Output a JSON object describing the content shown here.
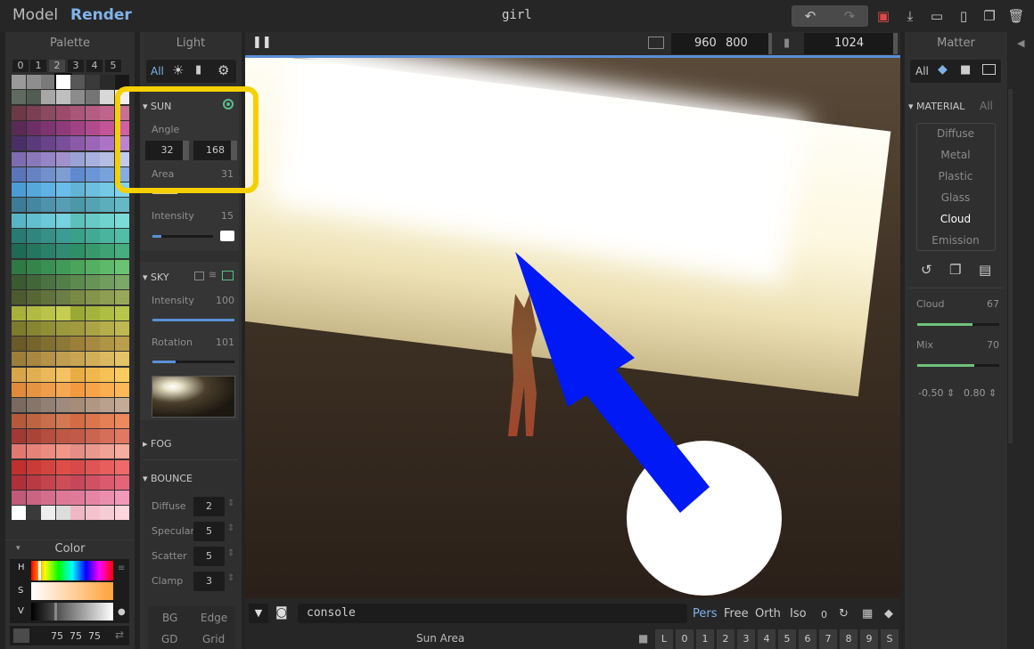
{
  "topbar": {
    "mode_model": "Model",
    "mode_render": "Render",
    "title": "girl"
  },
  "palette": {
    "title": "Palette",
    "slots": [
      "0",
      "1",
      "2",
      "3",
      "4",
      "5"
    ],
    "color_title": "Color",
    "hsv_labels": [
      "H",
      "S",
      "V"
    ],
    "rgb": "75  75  75"
  },
  "light": {
    "title": "Light",
    "tab_all": "All",
    "sun": {
      "title": "SUN",
      "angle_label": "Angle",
      "angle_a": "32",
      "angle_b": "168",
      "area_label": "Area",
      "area_value": "31",
      "intensity_label": "Intensity",
      "intensity_value": "15"
    },
    "sky": {
      "title": "SKY",
      "intensity_label": "Intensity",
      "intensity_value": "100",
      "rotation_label": "Rotation",
      "rotation_value": "101"
    },
    "fog": {
      "title": "FOG"
    },
    "bounce": {
      "title": "BOUNCE",
      "rows": [
        {
          "label": "Diffuse",
          "value": "2"
        },
        {
          "label": "Specular",
          "value": "5"
        },
        {
          "label": "Scatter",
          "value": "5"
        },
        {
          "label": "Clamp",
          "value": "3"
        }
      ]
    },
    "bottom": {
      "bg": "BG",
      "edge": "Edge",
      "gd": "GD",
      "grid": "Grid"
    }
  },
  "viewport": {
    "width": "960",
    "height": "800",
    "samples": "1024",
    "console_placeholder": "console",
    "status": "Sun Area",
    "views": [
      "Pers",
      "Free",
      "Orth",
      "Iso"
    ],
    "zero": "0",
    "keys": [
      "L",
      "0",
      "1",
      "2",
      "3",
      "4",
      "5",
      "6",
      "7",
      "8",
      "9",
      "S"
    ]
  },
  "matter": {
    "title": "Matter",
    "tab_all": "All",
    "material_title": "MATERIAL",
    "material_all": "All",
    "materials": [
      "Diffuse",
      "Metal",
      "Plastic",
      "Glass",
      "Cloud",
      "Emission"
    ],
    "selected": "Cloud",
    "cloud_label": "Cloud",
    "cloud_value": "67",
    "mix_label": "Mix",
    "mix_value": "70",
    "n1": "-0.50",
    "n2": "0.80"
  },
  "colors": {
    "accent": "#7fb3e8",
    "highlight": "#f5d000",
    "arrow": "#0019f5"
  }
}
